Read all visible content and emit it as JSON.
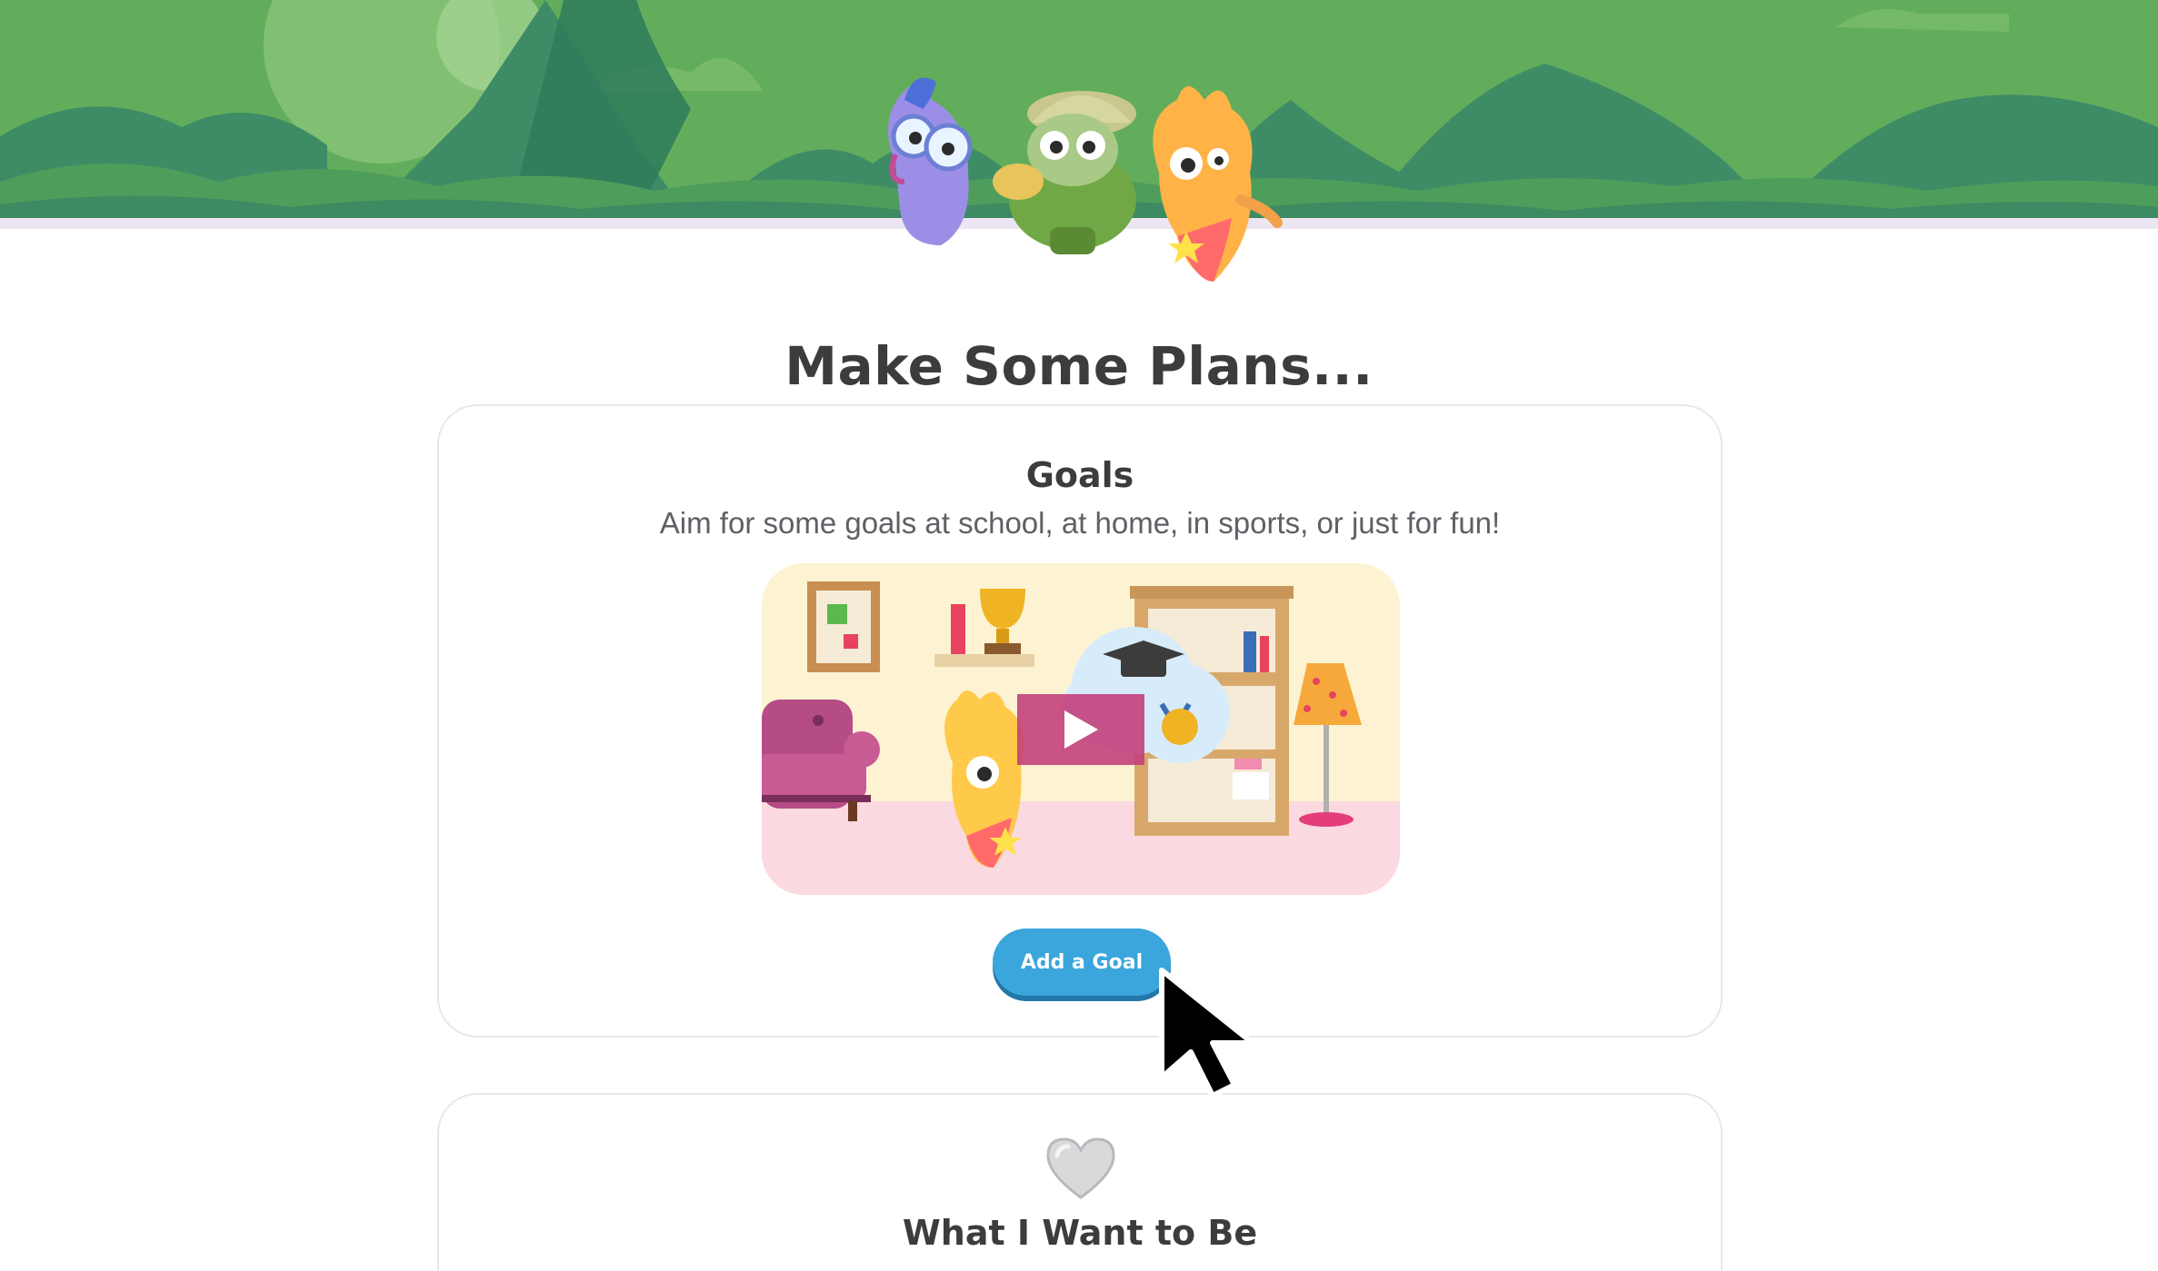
{
  "page": {
    "title": "Make Some Plans..."
  },
  "goals_card": {
    "title": "Goals",
    "description": "Aim for some goals at school, at home, in sports, or just for fun!",
    "video_icon": "play-icon",
    "button_label": "Add a Goal"
  },
  "want_card": {
    "icon": "heart-icon",
    "title": "What I Want to Be"
  },
  "colors": {
    "banner_green": "#5aa85a",
    "dark_green": "#3d8a63",
    "title_text": "#3c3c3c",
    "button_blue": "#3aa6dc",
    "button_shadow": "#2377a8",
    "play_overlay": "#c23c78"
  }
}
